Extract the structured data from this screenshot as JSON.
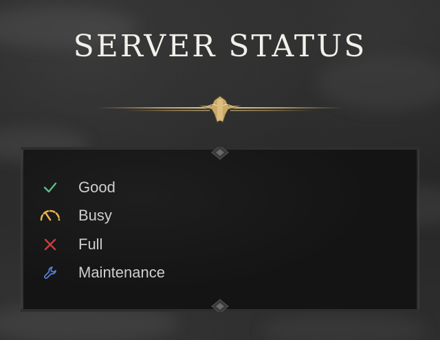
{
  "title": "SERVER STATUS",
  "legend": {
    "items": [
      {
        "icon": "check-icon",
        "label": "Good",
        "color": "#5fbf8a"
      },
      {
        "icon": "gauge-icon",
        "label": "Busy",
        "color": "#e8b34a"
      },
      {
        "icon": "x-icon",
        "label": "Full",
        "color": "#d43c3c"
      },
      {
        "icon": "wrench-icon",
        "label": "Maintenance",
        "color": "#5a7fd6"
      }
    ]
  },
  "colors": {
    "background": "#272727",
    "panel": "#141414",
    "gold": "#b9985a",
    "title": "#f2f0ea",
    "text": "#cfcfcf"
  }
}
